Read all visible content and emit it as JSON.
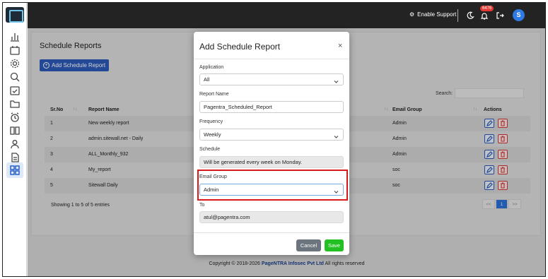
{
  "header": {
    "enable_support": "Enable Support",
    "notification_count": "6476",
    "avatar_initial": "S"
  },
  "page": {
    "title": "Schedule Reports",
    "add_button": "Add Schedule Report",
    "search_label": "Search:",
    "columns": {
      "srno": "Sr.No",
      "report_name": "Report Name",
      "email_group": "Email Group",
      "actions": "Actions"
    },
    "rows": [
      {
        "srno": "1",
        "name": "New weekly report",
        "group": "Admin"
      },
      {
        "srno": "2",
        "name": "admin.sitewall.net - Daily",
        "group": "Admin"
      },
      {
        "srno": "3",
        "name": "ALL_Monthly_932",
        "group": "Admin"
      },
      {
        "srno": "4",
        "name": "My_report",
        "group": "soc"
      },
      {
        "srno": "5",
        "name": "Sitewall Daily",
        "group": "soc"
      }
    ],
    "showing": "Showing 1 to 5 of 5 entries",
    "pager": {
      "prev": "<<",
      "current": "1",
      "next": ">>"
    },
    "footer_prefix": "Copyright © 2018-2026 ",
    "footer_company": "PageNTRA Infosec Pvt Ltd",
    "footer_suffix": " All rights reserved"
  },
  "modal": {
    "title": "Add Schedule Report",
    "close": "×",
    "application_label": "Application",
    "application_value": "All",
    "report_name_label": "Report Name",
    "report_name_value": "Pagentra_Scheduled_Report",
    "frequency_label": "Frequency",
    "frequency_value": "Weekly",
    "schedule_label": "Schedule",
    "schedule_value": "Will be generated every week on Monday.",
    "email_group_label": "Email Group",
    "email_group_value": "Admin",
    "to_label": "To",
    "to_value": "atul@pagentra.com",
    "cancel": "Cancel",
    "save": "Save"
  }
}
